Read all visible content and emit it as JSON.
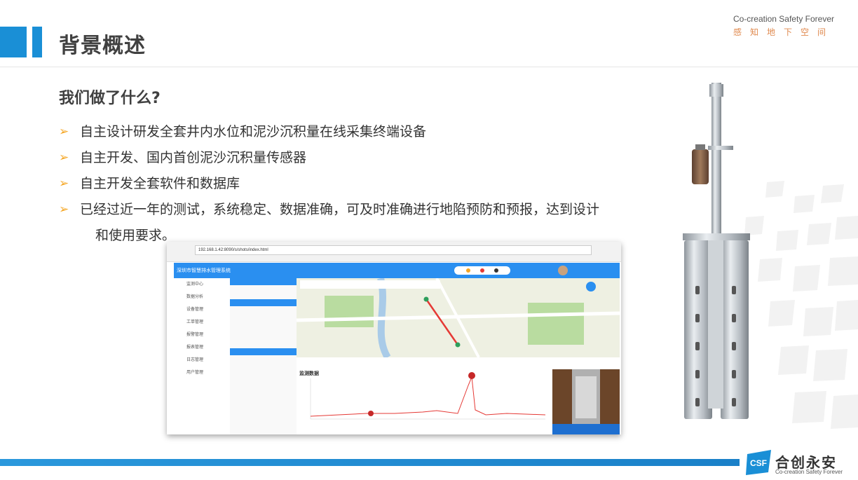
{
  "header": {
    "title": "背景概述",
    "tagline_en": "Co-creation Safety Forever",
    "tagline_cn": "感知地下空间"
  },
  "section": {
    "subtitle": "我们做了什么?",
    "bullets": [
      "自主设计研发全套井内水位和泥沙沉积量在线采集终端设备",
      "自主开发、国内首创泥沙沉积量传感器",
      "自主开发全套软件和数据库",
      "已经过近一年的测试，系统稳定、数据准确，可及时准确进行地陷预防和预报，达到设计"
    ],
    "bullet_continuation": "和使用要求。",
    "bullet_marker": "➢"
  },
  "screenshot": {
    "url": "192.168.1.42:8090/s/shots/index.html",
    "app_title": "深圳市智慧排水管理系统",
    "chart_title": "监测数据",
    "sidebar": [
      "监测中心",
      "数据分析",
      "设备管理",
      "工单管理",
      "报警管理",
      "报表管理",
      "日志管理",
      "用户管理"
    ]
  },
  "logo": {
    "mark": "CSF",
    "cn": "合创永安",
    "en": "Co-creation Safety Forever"
  },
  "colors": {
    "accent_blue": "#1a8fd6",
    "bullet_orange": "#f5a623",
    "tagline_orange": "#e08a4f",
    "text_dark": "#404040"
  }
}
